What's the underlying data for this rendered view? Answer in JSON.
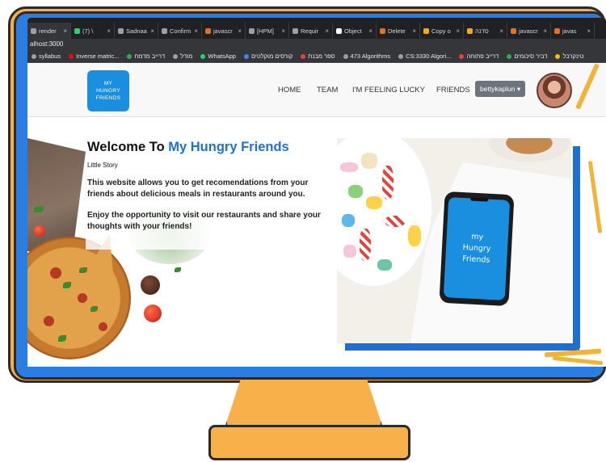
{
  "browser": {
    "tabs": [
      {
        "label": "render",
        "color": "#9aa0a6"
      },
      {
        "label": "(7) \\",
        "color": "#25d366"
      },
      {
        "label": "Sadnaa",
        "color": "#9aa0a6"
      },
      {
        "label": "Confirm",
        "color": "#9aa0a6"
      },
      {
        "label": "javascr",
        "color": "#e8710a"
      },
      {
        "label": "[HPM]",
        "color": "#9aa0a6"
      },
      {
        "label": "Requir",
        "color": "#9aa0a6"
      },
      {
        "label": "Object",
        "color": "#ffffff"
      },
      {
        "label": "Delete",
        "color": "#e8710a"
      },
      {
        "label": "Copy o",
        "color": "#f9ab00"
      },
      {
        "label": "סדנה",
        "color": "#f9ab00"
      },
      {
        "label": "javascr",
        "color": "#e8710a"
      },
      {
        "label": "javas",
        "color": "#e8710a"
      }
    ],
    "address": "alhost:3000",
    "bookmarks": [
      {
        "label": "syllabus",
        "color": "#9aa0a6"
      },
      {
        "label": "Inverse matric...",
        "color": "#ff0000"
      },
      {
        "label": "דרייב מדמח",
        "color": "#34a853"
      },
      {
        "label": "מודל",
        "color": "#9aa0a6"
      },
      {
        "label": "WhatsApp",
        "color": "#25d366"
      },
      {
        "label": "קורסים מוקלטים",
        "color": "#4285f4"
      },
      {
        "label": "ספר מבנת",
        "color": "#ea4335"
      },
      {
        "label": "473 Algorithms",
        "color": "#9aa0a6"
      },
      {
        "label": "CS:3330 Algori...",
        "color": "#9aa0a6"
      },
      {
        "label": "דרייב פתוחה",
        "color": "#ea4335"
      },
      {
        "label": "דביר סיכומים",
        "color": "#34a853"
      },
      {
        "label": "טינקרבל",
        "color": "#fbbc04"
      }
    ]
  },
  "site": {
    "logo_lines": [
      "MY",
      "HUNGRY",
      "FRIENDS"
    ],
    "nav": {
      "home": "HOME",
      "team": "TEAM",
      "lucky": "I'M FEELING LUCKY",
      "friends": "FRIENDS",
      "user": "bettykaplun ▾"
    },
    "hero": {
      "welcome_prefix": "Welcome To",
      "welcome_brand": "My Hungry Friends",
      "subtitle": "Little Story",
      "paragraph1": "This website allows you to get recomendations from your friends about delicious meals in restaurants around you.",
      "paragraph2": "Enjoy the opportunity to visit our restaurants and share your thoughts with your friends!",
      "phone_lines": [
        "my",
        "Hungry",
        "Friends"
      ]
    }
  },
  "colors": {
    "brand_blue": "#1f6fd1",
    "logo_blue": "#1a8fe0",
    "monitor_orange": "#f7b04a",
    "bezel_blue": "#2a7de1"
  }
}
